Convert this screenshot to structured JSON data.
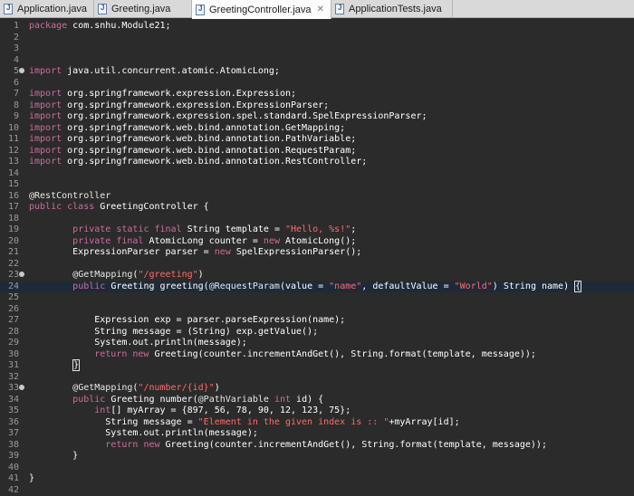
{
  "tabs": [
    {
      "label": "Application.java",
      "active": false
    },
    {
      "label": "Greeting.java",
      "active": false
    },
    {
      "label": "GreetingController.java",
      "active": true
    },
    {
      "label": "ApplicationTests.java",
      "active": false
    }
  ],
  "close_symbol": "✕",
  "colors": {
    "background": "#2b2b2b",
    "keyword": "#cc6d9c",
    "string": "#ff6a6a",
    "text": "#ffffff",
    "line_number": "#9a9a9a"
  },
  "lines": [
    {
      "n": "1",
      "tokens": [
        [
          "kw",
          "package"
        ],
        [
          "t",
          " com.snhu.Module21;"
        ]
      ]
    },
    {
      "n": "2",
      "tokens": []
    },
    {
      "n": "3",
      "tokens": []
    },
    {
      "n": "4",
      "tokens": []
    },
    {
      "n": "5",
      "fold": true,
      "tokens": [
        [
          "kw",
          "import"
        ],
        [
          "t",
          " java.util.concurrent.atomic.AtomicLong;"
        ]
      ]
    },
    {
      "n": "6",
      "tokens": []
    },
    {
      "n": "7",
      "tokens": [
        [
          "kw",
          "import"
        ],
        [
          "t",
          " org.springframework.expression.Expression;"
        ]
      ]
    },
    {
      "n": "8",
      "tokens": [
        [
          "kw",
          "import"
        ],
        [
          "t",
          " org.springframework.expression.ExpressionParser;"
        ]
      ]
    },
    {
      "n": "9",
      "tokens": [
        [
          "kw",
          "import"
        ],
        [
          "t",
          " org.springframework.expression.spel.standard.SpelExpressionParser;"
        ]
      ]
    },
    {
      "n": "10",
      "tokens": [
        [
          "kw",
          "import"
        ],
        [
          "t",
          " org.springframework.web.bind.annotation.GetMapping;"
        ]
      ]
    },
    {
      "n": "11",
      "tokens": [
        [
          "kw",
          "import"
        ],
        [
          "t",
          " org.springframework.web.bind.annotation.PathVariable;"
        ]
      ]
    },
    {
      "n": "12",
      "tokens": [
        [
          "kw",
          "import"
        ],
        [
          "t",
          " org.springframework.web.bind.annotation.RequestParam;"
        ]
      ]
    },
    {
      "n": "13",
      "tokens": [
        [
          "kw",
          "import"
        ],
        [
          "t",
          " org.springframework.web.bind.annotation.RestController;"
        ]
      ]
    },
    {
      "n": "14",
      "tokens": []
    },
    {
      "n": "15",
      "tokens": []
    },
    {
      "n": "16",
      "tokens": [
        [
          "ann",
          "@RestController"
        ]
      ]
    },
    {
      "n": "17",
      "tokens": [
        [
          "kw",
          "public class"
        ],
        [
          "t",
          " GreetingController {"
        ]
      ]
    },
    {
      "n": "18",
      "tokens": []
    },
    {
      "n": "19",
      "tokens": [
        [
          "t",
          "        "
        ],
        [
          "kw",
          "private static final"
        ],
        [
          "t",
          " String template = "
        ],
        [
          "str",
          "\"Hello, %s!\""
        ],
        [
          "t",
          ";"
        ]
      ]
    },
    {
      "n": "20",
      "tokens": [
        [
          "t",
          "        "
        ],
        [
          "kw",
          "private final"
        ],
        [
          "t",
          " AtomicLong counter = "
        ],
        [
          "kw",
          "new"
        ],
        [
          "t",
          " AtomicLong();"
        ]
      ]
    },
    {
      "n": "21",
      "tokens": [
        [
          "t",
          "        ExpressionParser parser = "
        ],
        [
          "kw",
          "new"
        ],
        [
          "t",
          " SpelExpressionParser();"
        ]
      ]
    },
    {
      "n": "22",
      "tokens": []
    },
    {
      "n": "23",
      "fold": true,
      "tokens": [
        [
          "t",
          "        "
        ],
        [
          "ann",
          "@GetMapping"
        ],
        [
          "t",
          "("
        ],
        [
          "str",
          "\"/greeting\""
        ],
        [
          "t",
          ")"
        ]
      ]
    },
    {
      "n": "24",
      "highlight": true,
      "tokens": [
        [
          "t",
          "        "
        ],
        [
          "kw",
          "public"
        ],
        [
          "t",
          " Greeting greeting("
        ],
        [
          "ann",
          "@RequestParam"
        ],
        [
          "t",
          "(value = "
        ],
        [
          "str",
          "\"name\""
        ],
        [
          "t",
          ", defaultValue = "
        ],
        [
          "str",
          "\"World\""
        ],
        [
          "t",
          ") String name) "
        ],
        [
          "caret",
          "{"
        ]
      ]
    },
    {
      "n": "25",
      "tokens": []
    },
    {
      "n": "26",
      "tokens": []
    },
    {
      "n": "27",
      "tokens": [
        [
          "t",
          "            Expression exp = parser.parseExpression(name);"
        ]
      ]
    },
    {
      "n": "28",
      "tokens": [
        [
          "t",
          "            String message = (String) exp.getValue();"
        ]
      ]
    },
    {
      "n": "29",
      "tokens": [
        [
          "t",
          "            System.out.println(message);"
        ]
      ]
    },
    {
      "n": "30",
      "tokens": [
        [
          "t",
          "            "
        ],
        [
          "kw",
          "return new"
        ],
        [
          "t",
          " Greeting(counter.incrementAndGet(), String.format(template, message));"
        ]
      ]
    },
    {
      "n": "31",
      "tokens": [
        [
          "t",
          "        "
        ],
        [
          "caret",
          "}"
        ]
      ]
    },
    {
      "n": "32",
      "tokens": []
    },
    {
      "n": "33",
      "fold": true,
      "tokens": [
        [
          "t",
          "        "
        ],
        [
          "ann",
          "@GetMapping"
        ],
        [
          "t",
          "("
        ],
        [
          "str",
          "\"/number/{id}\""
        ],
        [
          "t",
          ")"
        ]
      ]
    },
    {
      "n": "34",
      "tokens": [
        [
          "t",
          "        "
        ],
        [
          "kw",
          "public"
        ],
        [
          "t",
          " Greeting number("
        ],
        [
          "ann",
          "@PathVariable"
        ],
        [
          "t",
          " "
        ],
        [
          "kw",
          "int"
        ],
        [
          "t",
          " id) {"
        ]
      ]
    },
    {
      "n": "35",
      "tokens": [
        [
          "t",
          "            "
        ],
        [
          "kw",
          "int"
        ],
        [
          "t",
          "[] myArray = {897, 56, 78, 90, 12, 123, 75};"
        ]
      ]
    },
    {
      "n": "36",
      "tokens": [
        [
          "t",
          "              String message = "
        ],
        [
          "str",
          "\"Element in the given index is :: \""
        ],
        [
          "t",
          "+myArray[id];"
        ]
      ]
    },
    {
      "n": "37",
      "tokens": [
        [
          "t",
          "              System.out.println(message);"
        ]
      ]
    },
    {
      "n": "38",
      "tokens": [
        [
          "t",
          "              "
        ],
        [
          "kw",
          "return new"
        ],
        [
          "t",
          " Greeting(counter.incrementAndGet(), String.format(template, message));"
        ]
      ]
    },
    {
      "n": "39",
      "tokens": [
        [
          "t",
          "        }"
        ]
      ]
    },
    {
      "n": "40",
      "tokens": []
    },
    {
      "n": "41",
      "tokens": [
        [
          "t",
          "}"
        ]
      ]
    },
    {
      "n": "42",
      "tokens": []
    }
  ]
}
